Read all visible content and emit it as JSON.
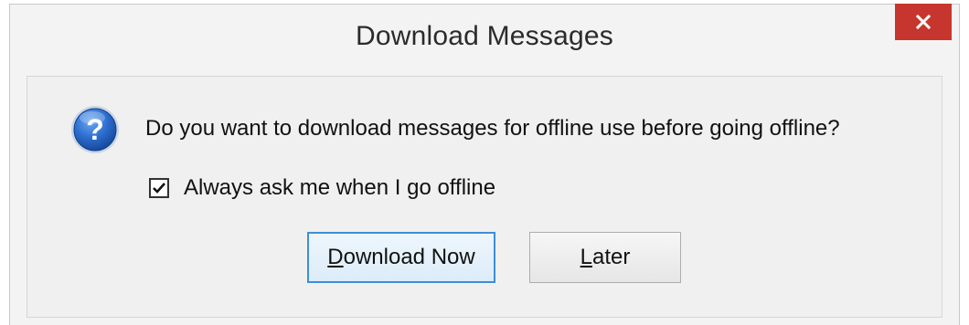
{
  "window": {
    "title": "Download Messages",
    "close_label": "×"
  },
  "dialog": {
    "icon": "question-icon",
    "message": "Do you want to download messages for offline use before going offline?",
    "checkbox": {
      "label": "Always ask me when I go offline",
      "checked": true
    },
    "buttons": {
      "download_now": {
        "mnemonic": "D",
        "rest": "ownload Now"
      },
      "later": {
        "mnemonic": "L",
        "rest": "ater"
      }
    }
  },
  "colors": {
    "close_button": "#c7362e",
    "primary_button_border": "#3c8fd6",
    "icon_blue": "#1f5fb8"
  }
}
